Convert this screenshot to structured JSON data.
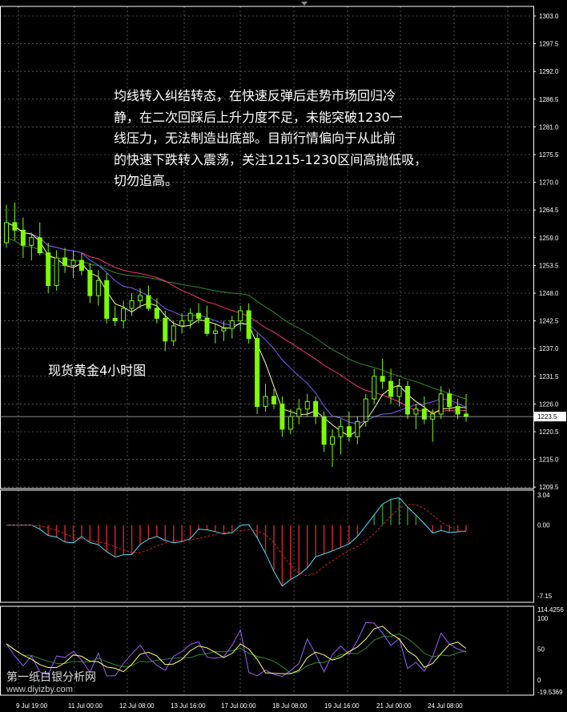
{
  "annotation": {
    "lines": [
      "均线转入纠结转态，在快速反弹后走势市场回归冷",
      "静，在二次回踩后上升力度不足，未能突破1230一",
      "线压力，无法制造出底部。目前行情偏向于从此前",
      "的快速下跌转入震荡，关注1215-1230区间高抛低吸，",
      "切勿追高。"
    ]
  },
  "subtitle": "现货黄金4小时图",
  "watermark": {
    "name": "第一纸白银分析网",
    "url": "www.diyizby.com"
  },
  "chart_data": [
    {
      "type": "candlestick",
      "panel": "price",
      "yaxis_ticks": [
        "1303.0",
        "1297.5",
        "1292.0",
        "1286.5",
        "1281.0",
        "1275.5",
        "1270.0",
        "1264.5",
        "1259.0",
        "1253.5",
        "1248.0",
        "1242.5",
        "1237.0",
        "1231.5",
        "1226.0",
        "1220.5",
        "1215.0",
        "1209.5"
      ],
      "current_price": "1223.5",
      "xaxis_ticks": [
        "9 Jul 19:00",
        "11 Jul 00:00",
        "12 Jul 08:00",
        "13 Jul 16:00",
        "17 Jul 00:00",
        "18 Jul 08:00",
        "19 Jul 16:00",
        "21 Jul 00:00",
        "24 Jul 08:00"
      ],
      "colors": {
        "up": "#7CFC00",
        "down": "#7CFC00",
        "ma_fast": "#FFFFAA",
        "ma_mid": "#7B5CFF",
        "ma_slow": "#FF2D78",
        "ma_long": "#2E8B2E"
      },
      "series_ohlc": [
        [
          1258.0,
          1265.5,
          1257.0,
          1262.0
        ],
        [
          1262.0,
          1266.0,
          1258.5,
          1260.5
        ],
        [
          1260.5,
          1263.0,
          1255.0,
          1257.5
        ],
        [
          1257.5,
          1260.0,
          1254.5,
          1259.0
        ],
        [
          1259.0,
          1262.0,
          1255.5,
          1256.0
        ],
        [
          1256.0,
          1258.0,
          1248.0,
          1249.5
        ],
        [
          1249.5,
          1256.5,
          1248.5,
          1255.0
        ],
        [
          1255.0,
          1257.0,
          1252.0,
          1253.5
        ],
        [
          1253.5,
          1256.5,
          1251.0,
          1254.5
        ],
        [
          1254.5,
          1256.0,
          1251.5,
          1252.5
        ],
        [
          1252.5,
          1254.0,
          1246.0,
          1247.5
        ],
        [
          1247.5,
          1252.5,
          1245.5,
          1250.5
        ],
        [
          1250.5,
          1252.0,
          1242.0,
          1243.0
        ],
        [
          1243.0,
          1245.5,
          1241.5,
          1242.5
        ],
        [
          1242.5,
          1246.5,
          1241.0,
          1245.0
        ],
        [
          1245.0,
          1248.0,
          1243.5,
          1246.5
        ],
        [
          1246.5,
          1249.0,
          1245.0,
          1247.5
        ],
        [
          1247.5,
          1249.5,
          1244.5,
          1245.0
        ],
        [
          1245.0,
          1247.0,
          1242.0,
          1243.0
        ],
        [
          1243.0,
          1244.5,
          1236.5,
          1238.5
        ],
        [
          1238.5,
          1242.5,
          1237.5,
          1241.5
        ],
        [
          1241.5,
          1244.0,
          1240.0,
          1242.5
        ],
        [
          1242.5,
          1245.0,
          1241.0,
          1244.0
        ],
        [
          1244.0,
          1246.0,
          1242.0,
          1243.0
        ],
        [
          1243.0,
          1245.5,
          1239.5,
          1240.0
        ],
        [
          1240.0,
          1242.0,
          1238.0,
          1240.5
        ],
        [
          1240.5,
          1242.5,
          1238.5,
          1241.0
        ],
        [
          1241.0,
          1243.5,
          1239.0,
          1242.5
        ],
        [
          1242.5,
          1245.5,
          1240.5,
          1244.5
        ],
        [
          1244.5,
          1246.0,
          1238.0,
          1239.0
        ],
        [
          1239.0,
          1240.0,
          1224.0,
          1225.5
        ],
        [
          1225.5,
          1230.0,
          1224.5,
          1227.5
        ],
        [
          1227.5,
          1229.0,
          1225.0,
          1226.0
        ],
        [
          1226.0,
          1227.5,
          1219.5,
          1221.0
        ],
        [
          1221.0,
          1225.0,
          1220.0,
          1223.5
        ],
        [
          1223.5,
          1227.0,
          1222.0,
          1225.0
        ],
        [
          1225.0,
          1228.0,
          1223.5,
          1226.5
        ],
        [
          1226.5,
          1227.5,
          1222.0,
          1223.5
        ],
        [
          1223.5,
          1224.5,
          1216.5,
          1218.0
        ],
        [
          1218.0,
          1221.0,
          1213.5,
          1219.5
        ],
        [
          1219.5,
          1223.0,
          1216.0,
          1221.5
        ],
        [
          1221.5,
          1224.5,
          1218.5,
          1219.5
        ],
        [
          1219.5,
          1223.5,
          1218.0,
          1222.5
        ],
        [
          1222.5,
          1228.0,
          1221.5,
          1227.0
        ],
        [
          1227.0,
          1233.0,
          1226.0,
          1231.5
        ],
        [
          1231.5,
          1235.0,
          1229.0,
          1230.5
        ],
        [
          1230.5,
          1233.0,
          1226.0,
          1227.5
        ],
        [
          1227.5,
          1231.0,
          1225.5,
          1229.5
        ],
        [
          1229.5,
          1230.5,
          1223.0,
          1224.0
        ],
        [
          1224.0,
          1226.0,
          1221.0,
          1225.0
        ],
        [
          1225.0,
          1227.5,
          1222.0,
          1223.0
        ],
        [
          1223.0,
          1225.0,
          1218.5,
          1224.0
        ],
        [
          1224.0,
          1229.5,
          1223.0,
          1228.0
        ],
        [
          1228.0,
          1229.0,
          1224.5,
          1225.5
        ],
        [
          1225.5,
          1227.0,
          1223.0,
          1224.0
        ],
        [
          1224.0,
          1228.0,
          1222.5,
          1223.5
        ]
      ]
    },
    {
      "type": "macd",
      "panel": "macd",
      "yaxis_ticks": [
        "3.04",
        "0.00",
        "-7.15"
      ],
      "colors": {
        "pos": "#2E8B2E",
        "neg": "#CC2222",
        "main": "#4FE0FF",
        "signal": "#CC2222"
      }
    },
    {
      "type": "oscillator",
      "panel": "stoch",
      "yaxis_ticks": [
        "114.4256",
        "100",
        "50",
        "0",
        "-19.5369"
      ],
      "colors": {
        "k": "#9B5CFF",
        "d": "#FFFF66",
        "e": "#2E8B2E"
      }
    }
  ]
}
